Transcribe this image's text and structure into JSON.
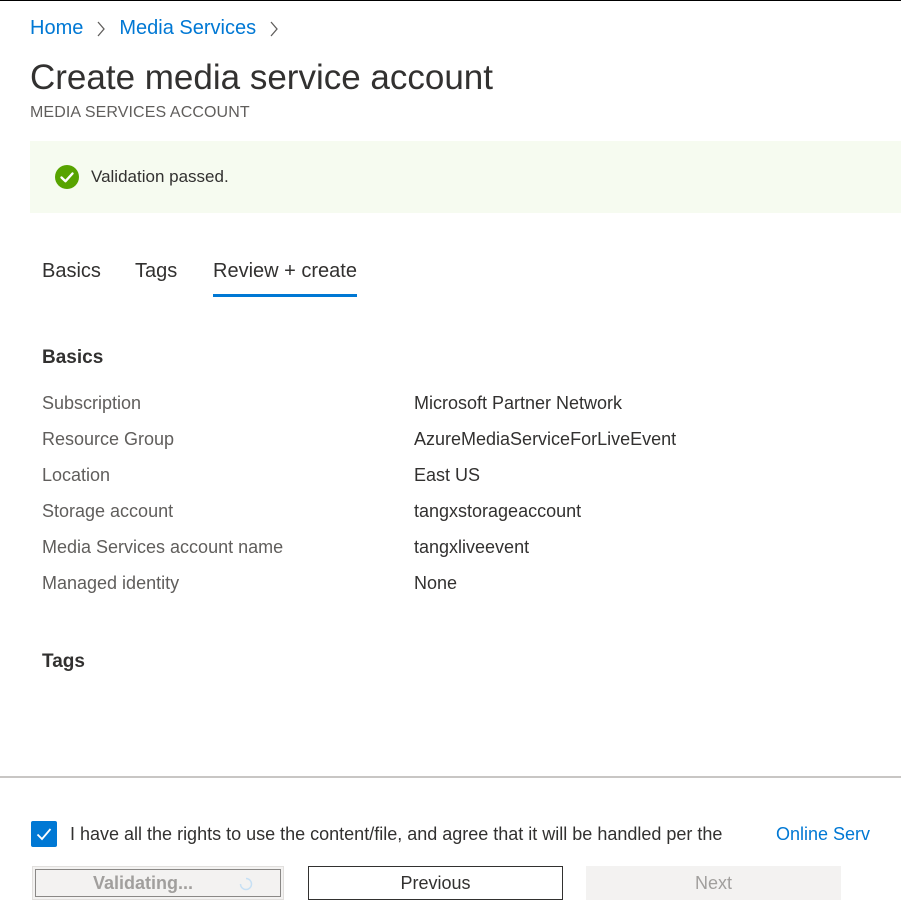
{
  "breadcrumb": {
    "items": [
      "Home",
      "Media Services"
    ]
  },
  "page": {
    "title": "Create media service account",
    "subtitle": "MEDIA SERVICES ACCOUNT"
  },
  "banner": {
    "message": "Validation passed.",
    "status_color": "#57a300"
  },
  "tabs": [
    {
      "label": "Basics",
      "active": false
    },
    {
      "label": "Tags",
      "active": false
    },
    {
      "label": "Review + create",
      "active": true
    }
  ],
  "basics": {
    "heading": "Basics",
    "rows": [
      {
        "label": "Subscription",
        "value": "Microsoft Partner Network"
      },
      {
        "label": "Resource Group",
        "value": "AzureMediaServiceForLiveEvent"
      },
      {
        "label": "Location",
        "value": "East US"
      },
      {
        "label": "Storage account",
        "value": "tangxstorageaccount"
      },
      {
        "label": "Media Services account name",
        "value": "tangxliveevent"
      },
      {
        "label": "Managed identity",
        "value": "None"
      }
    ]
  },
  "tags_section": {
    "heading": "Tags"
  },
  "agreement": {
    "checked": true,
    "text": "I have all the rights to use the content/file, and agree that it will be handled per the",
    "link_text": "Online Serv"
  },
  "buttons": {
    "validating": "Validating...",
    "previous": "Previous",
    "next": "Next"
  },
  "colors": {
    "accent": "#0078d4",
    "banner_bg": "#f6fbf0"
  }
}
